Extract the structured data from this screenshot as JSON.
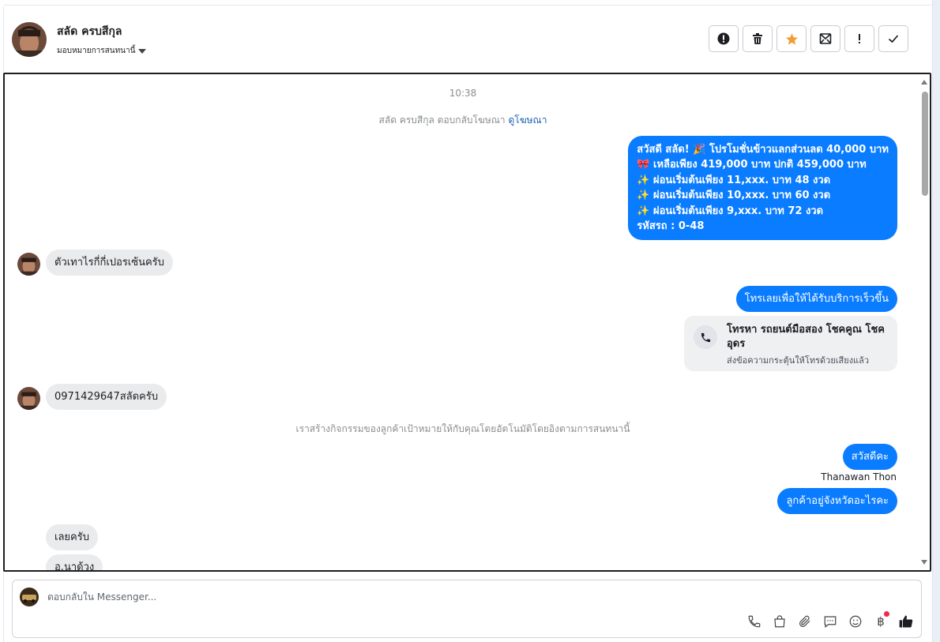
{
  "header": {
    "contact_name": "สลัด ครบสีกุล",
    "assign_label": "มอบหมายการสนทนานี้",
    "toolbar": [
      "alert-circle-icon",
      "trash-icon",
      "star-icon",
      "mark-unread-icon",
      "exclamation-icon",
      "check-icon"
    ]
  },
  "thread": {
    "timestamp": "10:38",
    "ad_reply_text": "สลัด ครบสีกุล ตอบกลับโฆษณา",
    "ad_link": "ดูโฆษณา",
    "promo_lines": [
      "สวัสดี สลัด! 🎉 โปรโมชั่นข้าวแลกส่วนลด 40,000 บาท",
      "🎀 เหลือเพียง 419,000 บาท ปกติ 459,000 บาท",
      "✨ ผ่อนเริ่มต้นเพียง 11,xxx. บาท 48 งวด",
      "✨ ผ่อนเริ่มต้นเพียง 10,xxx. บาท 60 งวด",
      "✨ ผ่อนเริ่มต้นเพียง 9,xxx. บาท 72 งวด",
      "รหัสรถ : 0-48"
    ],
    "in_msg_1": "ตัวเทาไรกี่กี่เปอรเซ้นครับ",
    "out_call_prompt": "โทรเลยเพื่อให้ได้รับบริการเร็วขึ้น",
    "call_card": {
      "title": "โทรหา รถยนต์มือสอง โชคคูณ โชค อุดร",
      "subtitle": "ส่งข้อความกระตุ้นให้โทรด้วยเสียงแล้ว"
    },
    "in_msg_2": "0971429647สลัดครับ",
    "system_activity": "เราสร้างกิจกรรมของลูกค้าเป้าหมายให้กับคุณโดยอัตโนมัติโดยอิงตามการสนทนานี้",
    "out_hello": "สวัสดีคะ",
    "agent_name": "Thanawan Thon",
    "out_province": "ลูกค้าอยู่จังหวัดอะไรคะ",
    "in_msg_3": "เลยครับ",
    "in_msg_4": "อ.นาด้วง"
  },
  "composer": {
    "placeholder": "ตอบกลับใน Messenger...",
    "tools": [
      "phone-icon",
      "shopping-bag-icon",
      "paperclip-icon",
      "chat-bubble-icon",
      "emoji-icon",
      "baht-icon",
      "thumbs-up-icon"
    ],
    "baht_symbol": "฿",
    "accent": "#0a7cff"
  }
}
